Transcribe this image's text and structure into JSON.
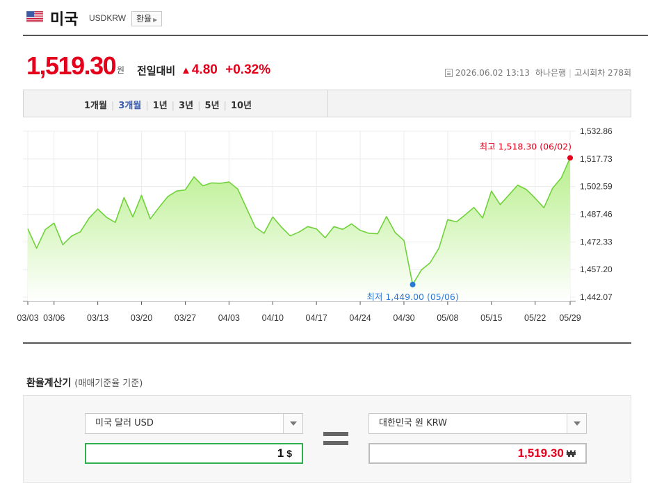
{
  "header": {
    "country": "미국",
    "code": "USDKRW",
    "fx_button": "환율"
  },
  "quote": {
    "price": "1,519.30",
    "currency_unit": "원",
    "change_label": "전일대비",
    "change_icon": "up-triangle-icon",
    "change_value": "4.80",
    "change_percent": "+0.32%",
    "datetime": "2026.06.02 13:13",
    "bank": "하나은행",
    "notice": "고시회차 278회"
  },
  "periods": [
    {
      "label": "1개월",
      "active": false
    },
    {
      "label": "3개월",
      "active": true
    },
    {
      "label": "1년",
      "active": false
    },
    {
      "label": "3년",
      "active": false
    },
    {
      "label": "5년",
      "active": false
    },
    {
      "label": "10년",
      "active": false
    }
  ],
  "colors": {
    "accent_red": "#e4001b",
    "accent_blue": "#2b78d6",
    "line_green": "#6fd23a",
    "fill_green": "#b8ef8c"
  },
  "chart_data": {
    "type": "area",
    "title": "",
    "xlabel": "",
    "ylabel": "",
    "ylim": [
      1442.07,
      1532.86
    ],
    "y_ticks": [
      "1,532.86",
      "1,517.73",
      "1,502.59",
      "1,487.46",
      "1,472.33",
      "1,457.20",
      "1,442.07"
    ],
    "y_tick_values": [
      1532.86,
      1517.73,
      1502.59,
      1487.46,
      1472.33,
      1457.2,
      1442.07
    ],
    "x_tick_labels": [
      "03/03",
      "03/06",
      "03/13",
      "03/20",
      "03/27",
      "04/03",
      "04/10",
      "04/17",
      "04/24",
      "04/30",
      "05/08",
      "05/15",
      "05/22",
      "05/29"
    ],
    "x_tick_index": [
      0,
      3,
      8,
      13,
      18,
      23,
      28,
      33,
      38,
      43,
      48,
      53,
      58,
      62
    ],
    "grid": true,
    "series": [
      {
        "values": [
          1479.5,
          1468.8,
          1479.1,
          1482.6,
          1470.8,
          1475.5,
          1477.8,
          1485.3,
          1490.3,
          1485.8,
          1483.0,
          1496.6,
          1486.0,
          1497.8,
          1484.9,
          1491.2,
          1497.1,
          1500.1,
          1500.8,
          1507.9,
          1503.0,
          1504.6,
          1504.4,
          1505.1,
          1501.2,
          1490.8,
          1480.4,
          1477.0,
          1486.0,
          1480.4,
          1475.6,
          1477.7,
          1480.7,
          1479.4,
          1474.6,
          1480.7,
          1479.2,
          1482.2,
          1478.6,
          1477.0,
          1476.8,
          1486.2,
          1477.4,
          1473.1,
          1449.0,
          1457.0,
          1460.9,
          1468.9,
          1484.5,
          1483.3,
          1487.1,
          1491.2,
          1485.4,
          1500.1,
          1492.7,
          1498.0,
          1503.4,
          1501.0,
          1496.2,
          1491.0,
          1501.7,
          1507.4,
          1518.3
        ]
      }
    ],
    "annotations": {
      "max_label": "최고 1,518.30 (06/02)",
      "min_label": "최저 1,449.00 (05/06)",
      "max_index": 62,
      "min_index": 44
    }
  },
  "calculator": {
    "title": "환율계산기",
    "subtitle": "(매매기준율 기준)",
    "from_currency": "미국 달러 USD",
    "from_value": "1",
    "from_unit": "$",
    "to_currency": "대한민국 원 KRW",
    "to_value": "1,519.30",
    "to_unit": "₩"
  }
}
